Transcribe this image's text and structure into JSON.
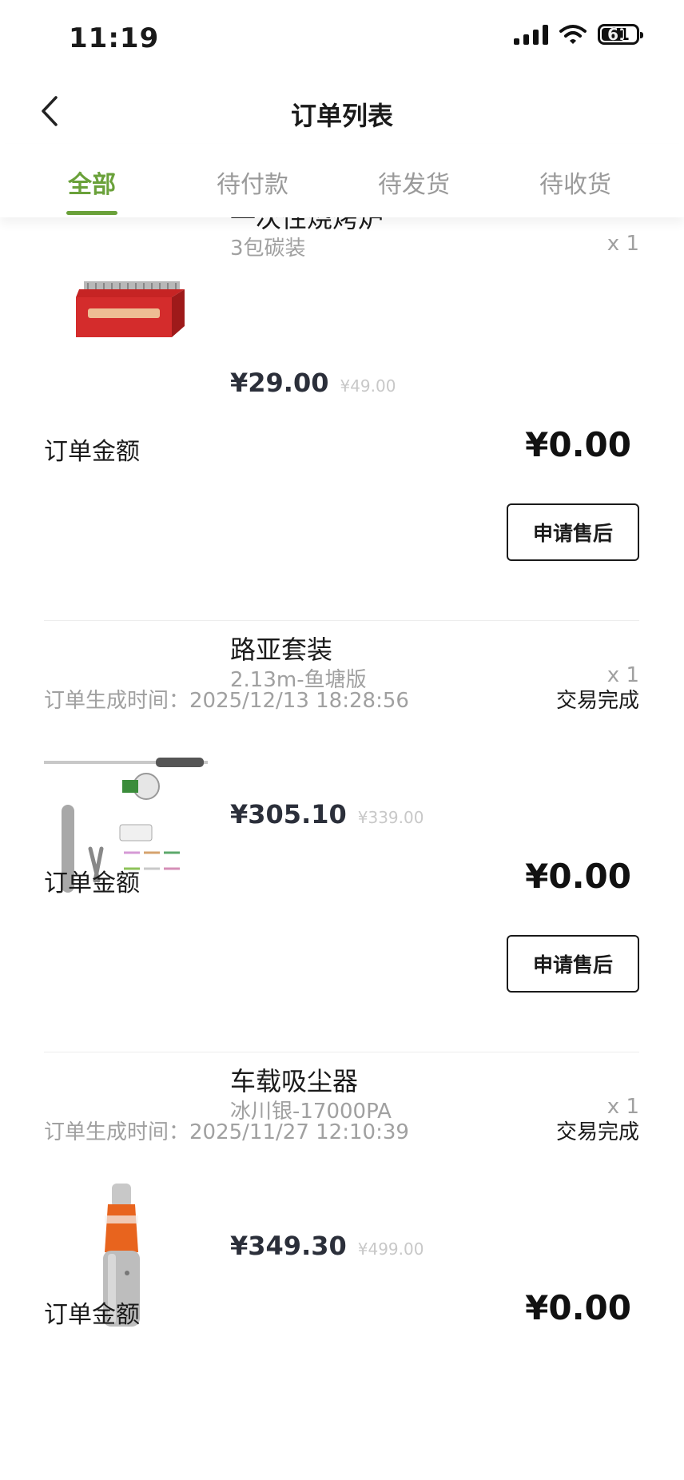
{
  "status_bar": {
    "time": "11:19",
    "battery": "61"
  },
  "header": {
    "title": "订单列表"
  },
  "tabs": [
    {
      "label": "全部",
      "active": true
    },
    {
      "label": "待付款",
      "active": false
    },
    {
      "label": "待发货",
      "active": false
    },
    {
      "label": "待收货",
      "active": false
    }
  ],
  "colors": {
    "accent": "#6aa13a",
    "muted": "#a0a0a0"
  },
  "orders": [
    {
      "product_name": "一次性烧烤炉",
      "spec": "3包碳装",
      "qty": "x 1",
      "price": "¥29.00",
      "original_price": "¥49.00",
      "amount_label": "订单金额",
      "amount": "¥0.00",
      "action_label": "申请售后",
      "thumb_icon": "disposable-grill-image"
    },
    {
      "created_label": "订单生成时间：",
      "created_time": "2025/12/13 18:28:56",
      "status": "交易完成",
      "product_name": "路亚套装",
      "spec": "2.13m-鱼塘版",
      "qty": "x 1",
      "price": "¥305.10",
      "original_price": "¥339.00",
      "amount_label": "订单金额",
      "amount": "¥0.00",
      "action_label": "申请售后",
      "thumb_icon": "lure-fishing-set-image"
    },
    {
      "created_label": "订单生成时间：",
      "created_time": "2025/11/27 12:10:39",
      "status": "交易完成",
      "product_name": "车载吸尘器",
      "spec": "冰川银-17000PA",
      "qty": "x 1",
      "price": "¥349.30",
      "original_price": "¥499.00",
      "amount_label": "订单金额",
      "amount": "¥0.00",
      "thumb_icon": "car-vacuum-image"
    }
  ]
}
